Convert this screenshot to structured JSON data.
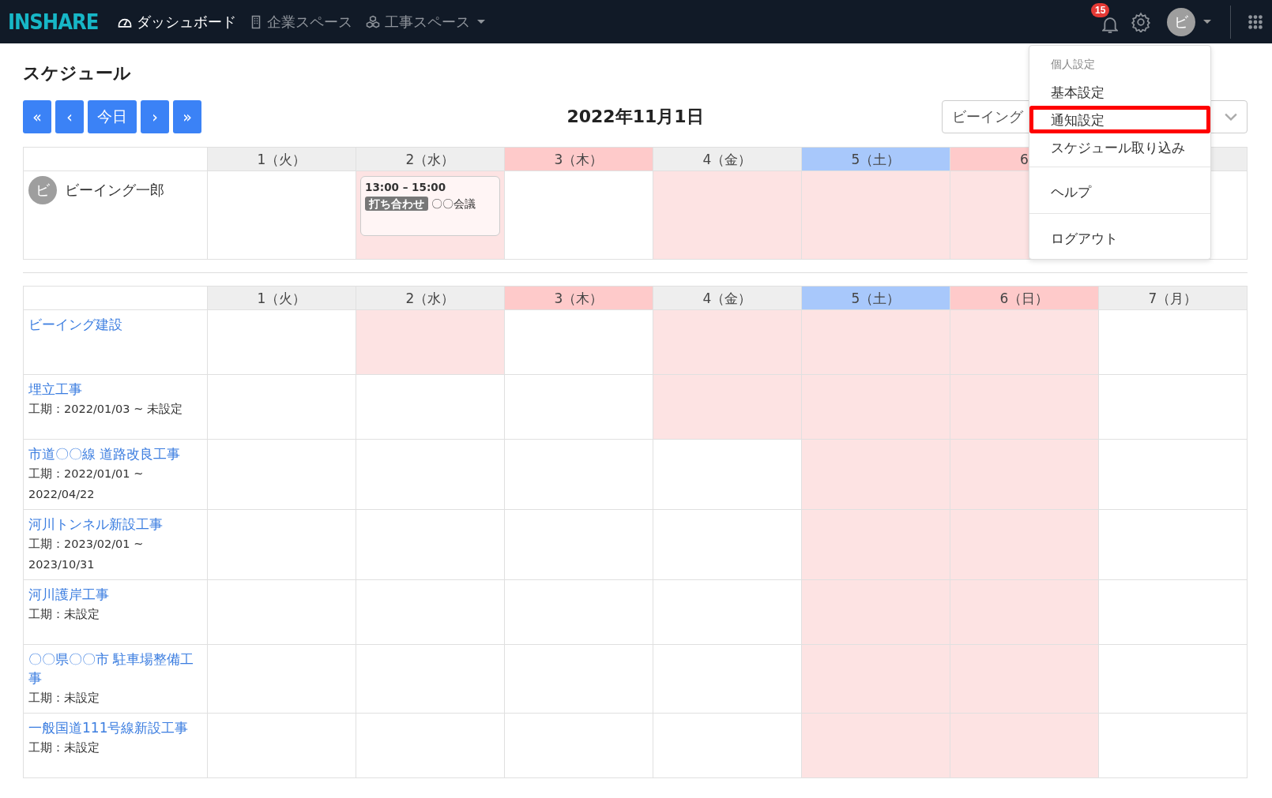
{
  "nav": {
    "logo": "INSHARE",
    "items": [
      {
        "label": "ダッシュボード",
        "selected": true,
        "dropdown": false
      },
      {
        "label": "企業スペース",
        "selected": false,
        "dropdown": false
      },
      {
        "label": "工事スペース",
        "selected": false,
        "dropdown": true
      }
    ],
    "notifications": "15",
    "avatar": "ビ"
  },
  "page_title": "スケジュール",
  "toolbar": {
    "buttons": [
      "«",
      "‹",
      "今日",
      "›",
      "»"
    ],
    "date": "2022年11月1日",
    "select": {
      "value": "ビーイング"
    }
  },
  "members_table": {
    "columns": [
      {
        "label": "1（火）",
        "kind": "weekday"
      },
      {
        "label": "2（水）",
        "kind": "weekday"
      },
      {
        "label": "3（木）",
        "kind": "holiday"
      },
      {
        "label": "4（金）",
        "kind": "weekday"
      },
      {
        "label": "5（土）",
        "kind": "saturday"
      },
      {
        "label": "6",
        "kind": "sunday"
      },
      {
        "kind": "weekday"
      }
    ],
    "rows": [
      {
        "name": "ビーイング一郎",
        "avatar": "ビ",
        "cells": [
          {
            "off": false
          },
          {
            "off": true,
            "events": [
              {
                "time": "13:00 – 15:00",
                "tag": "打ち合わせ",
                "title": "〇〇会議"
              }
            ]
          },
          {
            "off": false
          },
          {
            "off": true
          },
          {
            "off": true
          },
          {
            "off": true
          },
          {
            "off": false
          }
        ]
      }
    ]
  },
  "projects_table": {
    "columns": [
      {
        "label": "1（火）",
        "kind": "weekday"
      },
      {
        "label": "2（水）",
        "kind": "weekday"
      },
      {
        "label": "3（木）",
        "kind": "holiday"
      },
      {
        "label": "4（金）",
        "kind": "weekday"
      },
      {
        "label": "5（土）",
        "kind": "saturday"
      },
      {
        "label": "6（日）",
        "kind": "sunday"
      },
      {
        "label": "7（月）",
        "kind": "weekday"
      }
    ],
    "rows": [
      {
        "name": "ビーイング建設",
        "cells": [
          {
            "off": false
          },
          {
            "off": true
          },
          {
            "off": false
          },
          {
            "off": true
          },
          {
            "off": true
          },
          {
            "off": true
          },
          {
            "off": false
          }
        ]
      },
      {
        "name": "埋立工事",
        "period": "工期：2022/01/03 ~ 未設定",
        "cells": [
          {
            "off": false
          },
          {
            "off": false
          },
          {
            "off": false
          },
          {
            "off": true
          },
          {
            "off": true
          },
          {
            "off": true
          },
          {
            "off": false
          }
        ]
      },
      {
        "name": "市道〇〇線 道路改良工事",
        "period": "工期：2022/01/01 ~ 2022/04/22",
        "cells": [
          {
            "off": false
          },
          {
            "off": false
          },
          {
            "off": false
          },
          {
            "off": false
          },
          {
            "off": true
          },
          {
            "off": true
          },
          {
            "off": false
          }
        ]
      },
      {
        "name": "河川トンネル新設工事",
        "period": "工期：2023/02/01 ~ 2023/10/31",
        "cells": [
          {
            "off": false
          },
          {
            "off": false
          },
          {
            "off": false
          },
          {
            "off": false
          },
          {
            "off": true
          },
          {
            "off": true
          },
          {
            "off": false
          }
        ]
      },
      {
        "name": "河川護岸工事",
        "period": "工期：未設定",
        "cells": [
          {
            "off": false
          },
          {
            "off": false
          },
          {
            "off": false
          },
          {
            "off": false
          },
          {
            "off": true
          },
          {
            "off": true
          },
          {
            "off": false
          }
        ]
      },
      {
        "name": "〇〇県〇〇市 駐車場整備工事",
        "period": "工期：未設定",
        "cells": [
          {
            "off": false
          },
          {
            "off": false
          },
          {
            "off": false
          },
          {
            "off": false
          },
          {
            "off": true
          },
          {
            "off": true
          },
          {
            "off": false
          }
        ]
      },
      {
        "name": "一般国道111号線新設工事",
        "period": "工期：未設定",
        "cells": [
          {
            "off": false
          },
          {
            "off": false
          },
          {
            "off": false
          },
          {
            "off": false
          },
          {
            "off": true
          },
          {
            "off": true
          },
          {
            "off": false
          }
        ]
      }
    ]
  },
  "user_menu": {
    "items": [
      {
        "kind": "header",
        "label": "個人設定"
      },
      {
        "kind": "item",
        "label": "基本設定",
        "highlighted": false
      },
      {
        "kind": "item",
        "label": "通知設定",
        "highlighted": true
      },
      {
        "kind": "item",
        "label": "スケジュール取り込み",
        "highlighted": false
      },
      {
        "kind": "divider"
      },
      {
        "kind": "item",
        "label": "ヘルプ",
        "highlighted": false
      },
      {
        "kind": "divider"
      },
      {
        "kind": "item",
        "label": "ログアウト",
        "highlighted": false
      }
    ]
  }
}
